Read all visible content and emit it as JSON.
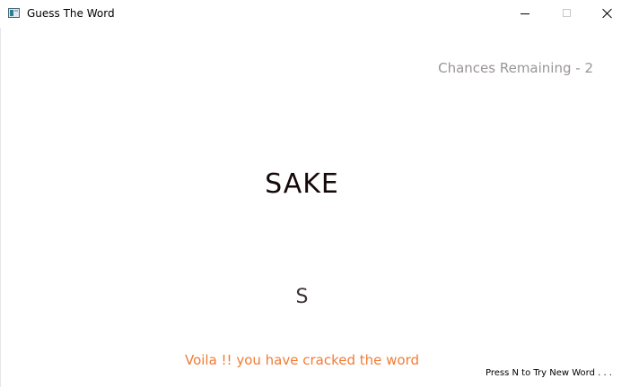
{
  "window": {
    "title": "Guess The Word",
    "icon": "app-window-icon",
    "controls": {
      "minimize_icon": "minimize-icon",
      "maximize_icon": "maximize-icon",
      "close_icon": "close-icon"
    }
  },
  "game": {
    "chances_text": "Chances Remaining - 2",
    "word": "SAKE",
    "last_guess": "S",
    "status_message": "Voila !! you have cracked the word",
    "hint": "Press N to Try New Word . . ."
  },
  "colors": {
    "chances": "#9a9595",
    "word": "#160808",
    "guess": "#3a3232",
    "status_message": "#f07c36",
    "hint": "#000000"
  }
}
